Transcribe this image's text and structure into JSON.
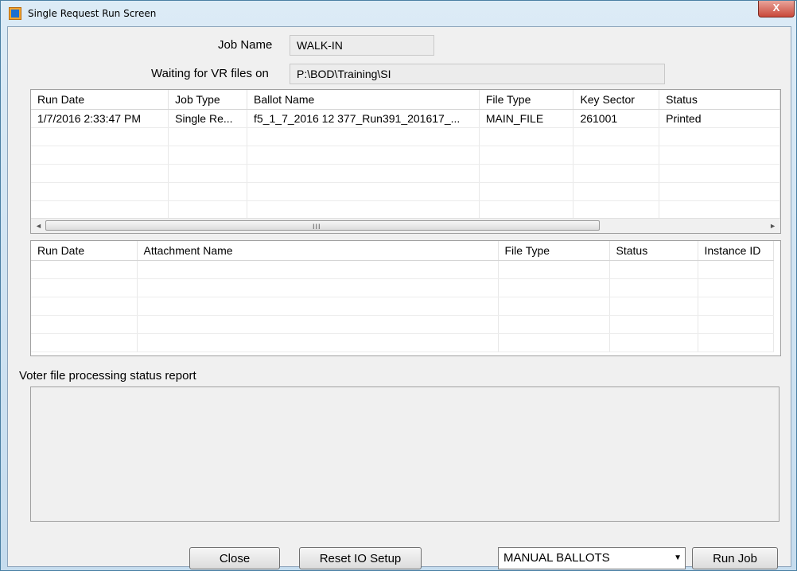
{
  "window": {
    "title": "Single Request Run Screen",
    "close_glyph": "X"
  },
  "form": {
    "job_name_label": "Job Name",
    "job_name_value": "WALK-IN",
    "waiting_label": "Waiting for VR files on",
    "waiting_value": "P:\\BOD\\Training\\SI"
  },
  "runs_grid": {
    "columns": [
      "Run Date",
      "Job Type",
      "Ballot Name",
      "File Type",
      "Key Sector",
      "Status"
    ],
    "rows": [
      [
        "1/7/2016 2:33:47 PM",
        "Single Re...",
        "f5_1_7_2016 12 377_Run391_201617_...",
        "MAIN_FILE",
        "261001",
        "Printed"
      ]
    ],
    "scroll_grip": "III",
    "scroll_left": "◄",
    "scroll_right": "►"
  },
  "attachments_grid": {
    "columns": [
      "Run Date",
      "Attachment Name",
      "File Type",
      "Status",
      "Instance ID"
    ],
    "rows": []
  },
  "report": {
    "label": "Voter file processing status report"
  },
  "buttons": {
    "close": "Close",
    "reset_io": "Reset IO Setup",
    "run_job": "Run Job"
  },
  "mode_select": {
    "selected": "MANUAL BALLOTS",
    "arrow": "▼"
  }
}
